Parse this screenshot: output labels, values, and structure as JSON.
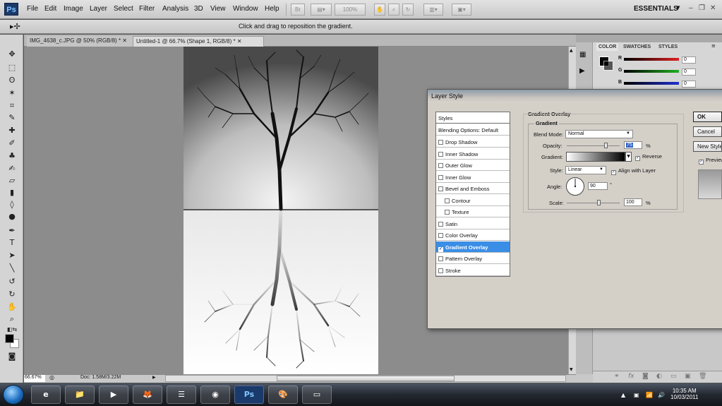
{
  "app": {
    "logo": "Ps",
    "menu": [
      "File",
      "Edit",
      "Image",
      "Layer",
      "Select",
      "Filter",
      "Analysis",
      "3D",
      "View",
      "Window",
      "Help"
    ],
    "zoom_dropdown": "100%",
    "workspace": "ESSENTIALS",
    "window_controls": [
      "–",
      "❐"
    ]
  },
  "options_bar": {
    "hint": "Click and drag to reposition the gradient."
  },
  "tabs": [
    {
      "label": "IMG_4638_c.JPG @ 50% (RGB/8) *"
    },
    {
      "label": "Untitled-1 @ 66.7% (Shape 1, RGB/8) *"
    }
  ],
  "status_bar": {
    "zoom": "66.67%",
    "doc_size": "Doc: 1.58M/3.22M"
  },
  "color_panel": {
    "tabs": [
      "COLOR",
      "SWATCHES",
      "STYLES"
    ],
    "channels": [
      {
        "label": "R",
        "value": "0",
        "color": "#e02020"
      },
      {
        "label": "G",
        "value": "0",
        "color": "#20b020"
      },
      {
        "label": "B",
        "value": "0",
        "color": "#2030d0"
      }
    ]
  },
  "dialog": {
    "title": "Layer Style",
    "styles_header": "Styles",
    "blending": "Blending Options: Default",
    "effects": [
      {
        "label": "Drop Shadow",
        "checked": false,
        "indent": false
      },
      {
        "label": "Inner Shadow",
        "checked": false,
        "indent": false
      },
      {
        "label": "Outer Glow",
        "checked": false,
        "indent": false
      },
      {
        "label": "Inner Glow",
        "checked": false,
        "indent": false
      },
      {
        "label": "Bevel and Emboss",
        "checked": false,
        "indent": false
      },
      {
        "label": "Contour",
        "checked": false,
        "indent": true
      },
      {
        "label": "Texture",
        "checked": false,
        "indent": true
      },
      {
        "label": "Satin",
        "checked": false,
        "indent": false
      },
      {
        "label": "Color Overlay",
        "checked": false,
        "indent": false
      },
      {
        "label": "Gradient Overlay",
        "checked": true,
        "indent": false,
        "selected": true
      },
      {
        "label": "Pattern Overlay",
        "checked": false,
        "indent": false
      },
      {
        "label": "Stroke",
        "checked": false,
        "indent": false
      }
    ],
    "section_title": "Gradient Overlay",
    "subsection_title": "Gradient",
    "blend_mode_label": "Blend Mode:",
    "blend_mode_value": "Normal",
    "opacity_label": "Opacity:",
    "opacity_value": "75",
    "gradient_label": "Gradient:",
    "reverse_label": "Reverse",
    "reverse_checked": true,
    "style_label": "Style:",
    "style_value": "Linear",
    "align_label": "Align with Layer",
    "align_checked": true,
    "angle_label": "Angle:",
    "angle_value": "90",
    "angle_unit": "°",
    "scale_label": "Scale:",
    "scale_value": "100",
    "percent": "%",
    "buttons": [
      "OK",
      "Cancel",
      "New Style...",
      "Preview"
    ],
    "preview_checked": true
  },
  "taskbar": {
    "time": "10:35 AM",
    "date": "10/03/2011",
    "apps": [
      "e",
      "📁",
      "▶",
      "🦊",
      "☰",
      "◉",
      "Ps",
      "🎨",
      "▭"
    ]
  }
}
